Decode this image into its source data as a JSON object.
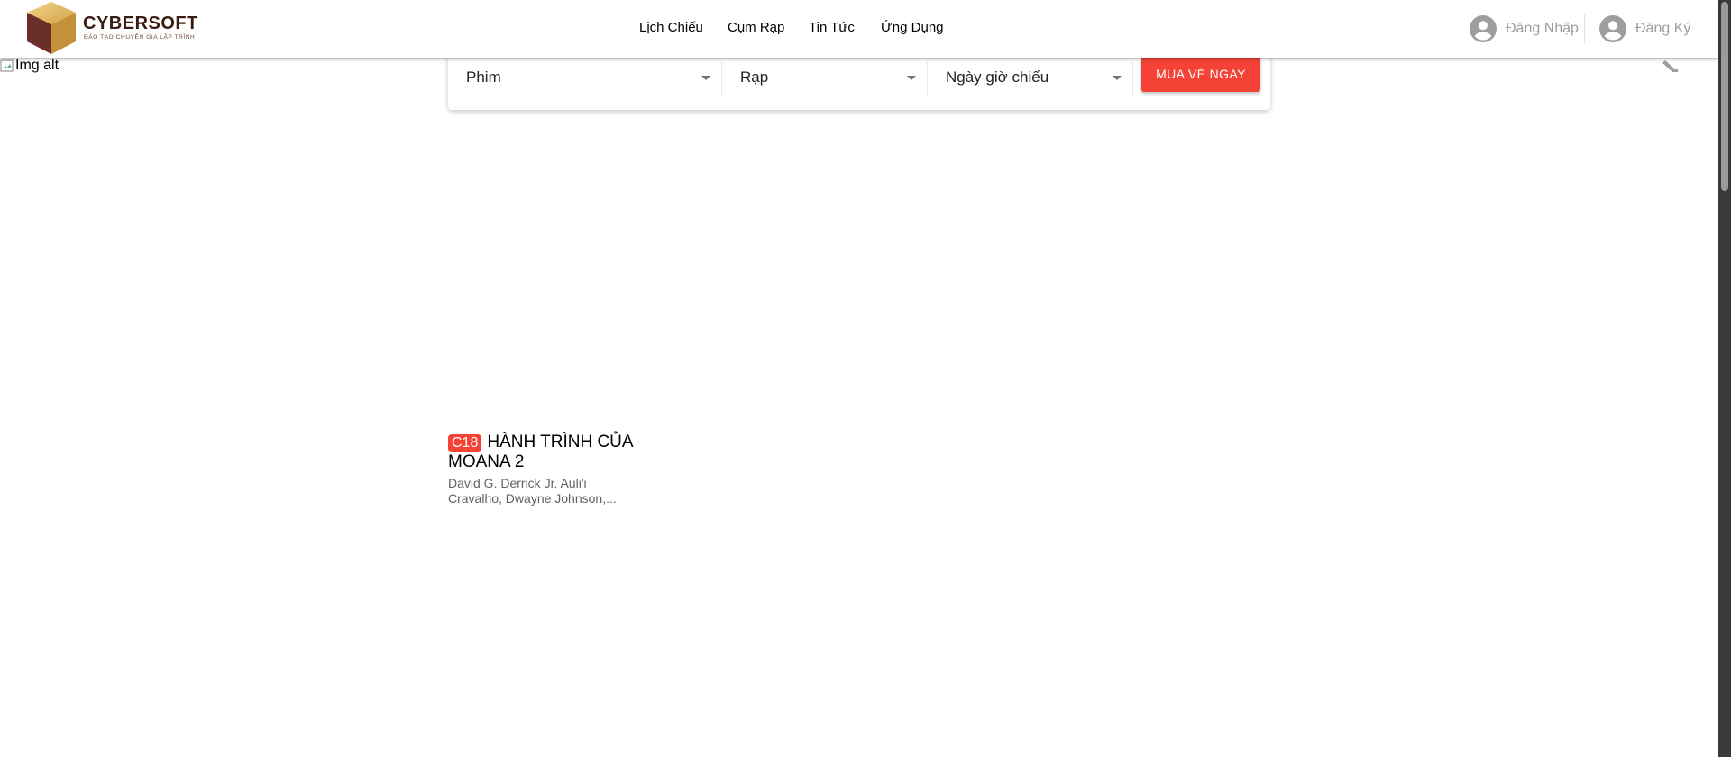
{
  "header": {
    "logo": {
      "brand": "CYBERSOFT",
      "tagline": "ĐÀO TẠO CHUYÊN GIA LẬP TRÌNH"
    },
    "nav": [
      {
        "label": "Lịch Chiếu"
      },
      {
        "label": "Cụm Rạp"
      },
      {
        "label": "Tin Tức"
      },
      {
        "label": "Ứng Dụng"
      }
    ],
    "auth": {
      "login_label": "Đăng Nhập",
      "register_label": "Đăng Ký",
      "icon": "account-circle-icon"
    }
  },
  "banner": {
    "image_alt": "Img alt"
  },
  "search": {
    "movie_select": "Phim",
    "cinema_select": "Rạp",
    "showtime_select": "Ngày giờ chiếu",
    "buy_button": "MUA VÉ NGAY"
  },
  "movies": [
    {
      "rating": "C18",
      "title": "HÀNH TRÌNH CỦA MOANA 2",
      "cast": "David G. Derrick Jr. Auli'i Cravalho, Dwayne Johnson,..."
    }
  ],
  "colors": {
    "accent": "#f44336",
    "auth_text": "#9e9e9e",
    "brand_text": "#3a1d12"
  }
}
